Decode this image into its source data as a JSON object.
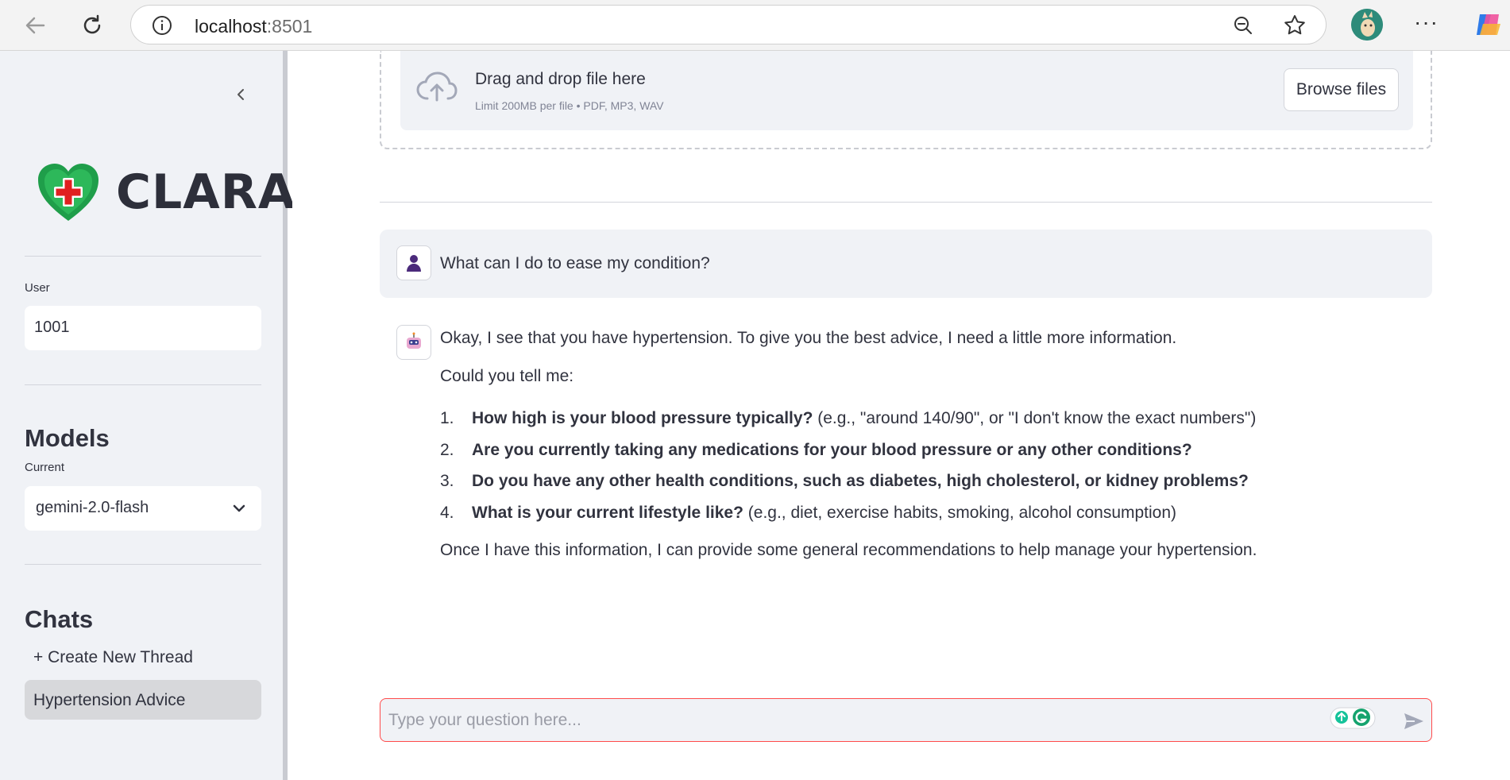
{
  "browser": {
    "url_host": "localhost",
    "url_port": ":8501"
  },
  "sidebar": {
    "logo_text": "CLARA",
    "user_label": "User",
    "user_value": "1001",
    "models_title": "Models",
    "current_label": "Current",
    "current_model": "gemini-2.0-flash",
    "chats_title": "Chats",
    "new_thread_label": "+ Create New Thread",
    "threads": [
      "Hypertension Advice"
    ]
  },
  "uploader": {
    "title": "Drag and drop file here",
    "limit": "Limit 200MB per file • PDF, MP3, WAV",
    "browse_label": "Browse files"
  },
  "chat": {
    "user_message": "What can I do to ease my condition?",
    "assistant": {
      "intro": "Okay, I see that you have hypertension. To give you the best advice, I need a little more information.",
      "ask": "Could you tell me:",
      "items": [
        {
          "num": "1.",
          "bold": "How high is your blood pressure typically?",
          "rest": " (e.g., \"around 140/90\", or \"I don't know the exact numbers\")"
        },
        {
          "num": "2.",
          "bold": "Are you currently taking any medications for your blood pressure or any other conditions?",
          "rest": ""
        },
        {
          "num": "3.",
          "bold": "Do you have any other health conditions, such as diabetes, high cholesterol, or kidney problems?",
          "rest": ""
        },
        {
          "num": "4.",
          "bold": "What is your current lifestyle like?",
          "rest": " (e.g., diet, exercise habits, smoking, alcohol consumption)"
        }
      ],
      "outro": "Once I have this information, I can provide some general recommendations to help manage your hypertension."
    },
    "input_placeholder": "Type your question here..."
  },
  "colors": {
    "accent": "#ff4b4b",
    "sidebar_bg": "#f0f2f6",
    "heart_green": "#1f9e4a",
    "cross_red": "#e02020"
  }
}
